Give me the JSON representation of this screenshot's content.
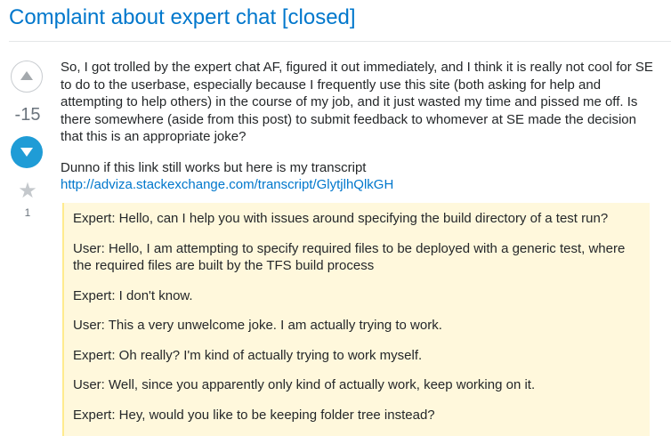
{
  "question": {
    "title": "Complaint about expert chat [closed]"
  },
  "votes": {
    "score": "-15",
    "favorite_count": "1"
  },
  "post": {
    "paragraph_1": "So, I got trolled by the expert chat AF, figured it out immediately, and I think it is really not cool for SE to do to the userbase, especially because I frequently use this site (both asking for help and attempting to help others) in the course of my job, and it just wasted my time and pissed me off. Is there somewhere (aside from this post) to submit feedback to whomever at SE made the decision that this is an appropriate joke?",
    "paragraph_2": "Dunno if this link still works but here is my transcript",
    "link_text": "http://adviza.stackexchange.com/transcript/GlytjlhQlkGH"
  },
  "transcript": [
    "Expert: Hello, can I help you with issues around specifying the build directory of a test run?",
    "User: Hello, I am attempting to specify required files to be deployed with a generic test, where the required files are built by the TFS build process",
    "Expert: I don't know.",
    "User: This a very unwelcome joke. I am actually trying to work.",
    "Expert: Oh really? I'm kind of actually trying to work myself.",
    "User: Well, since you apparently only kind of actually work, keep working on it.",
    "Expert: Hey, would you like to be keeping folder tree instead?"
  ],
  "icons": {
    "upvote": "triangle-up-circle-icon",
    "downvote": "triangle-down-circle-icon",
    "favorite": "star-icon"
  },
  "colors": {
    "title_link": "#0077cc",
    "downvote_active": "#1f9cd6",
    "blockquote_bg": "#fff8dc"
  }
}
